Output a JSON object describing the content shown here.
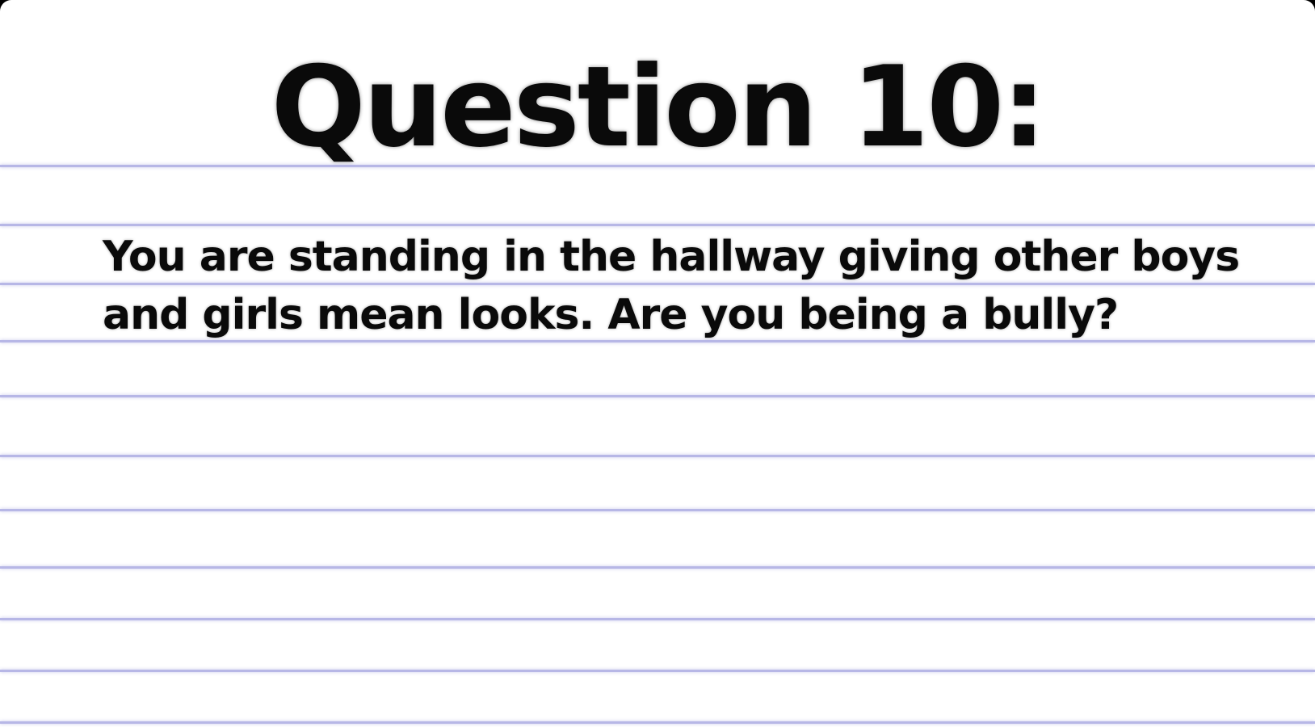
{
  "slide": {
    "title": "Question 10:",
    "question_text": "You are standing in the hallway giving other boys and girls mean looks. Are you being a bully?"
  },
  "colors": {
    "paper": "#ffffff",
    "rule_line": "#b7b7e6",
    "text": "#0a0a0a",
    "frame": "#000000"
  }
}
